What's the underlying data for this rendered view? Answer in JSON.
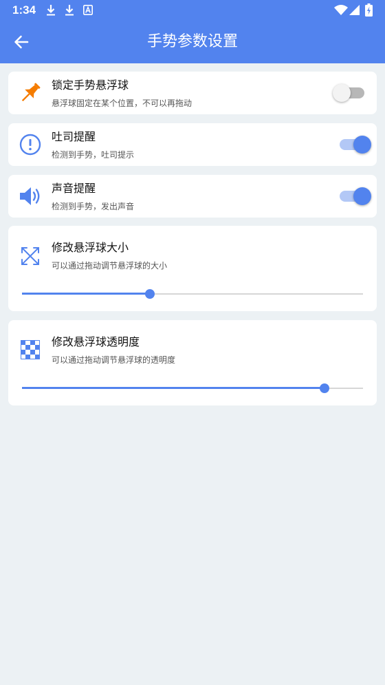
{
  "status_bar": {
    "time": "1:34"
  },
  "app_bar": {
    "title": "手势参数设置"
  },
  "settings": {
    "lock": {
      "title": "锁定手势悬浮球",
      "subtitle": "悬浮球固定在某个位置，不可以再拖动",
      "enabled": false
    },
    "toast": {
      "title": "吐司提醒",
      "subtitle": "检测到手势，吐司提示",
      "enabled": true
    },
    "sound": {
      "title": "声音提醒",
      "subtitle": "检测到手势，发出声音",
      "enabled": true
    },
    "size": {
      "title": "修改悬浮球大小",
      "subtitle": "可以通过拖动调节悬浮球的大小",
      "value_fraction": 0.376
    },
    "opacity": {
      "title": "修改悬浮球透明度",
      "subtitle": "可以通过拖动调节悬浮球的透明度",
      "value_fraction": 0.888
    }
  },
  "colors": {
    "primary": "#5283ee",
    "pin_orange": "#f57c00",
    "background": "#ecf1f4"
  }
}
